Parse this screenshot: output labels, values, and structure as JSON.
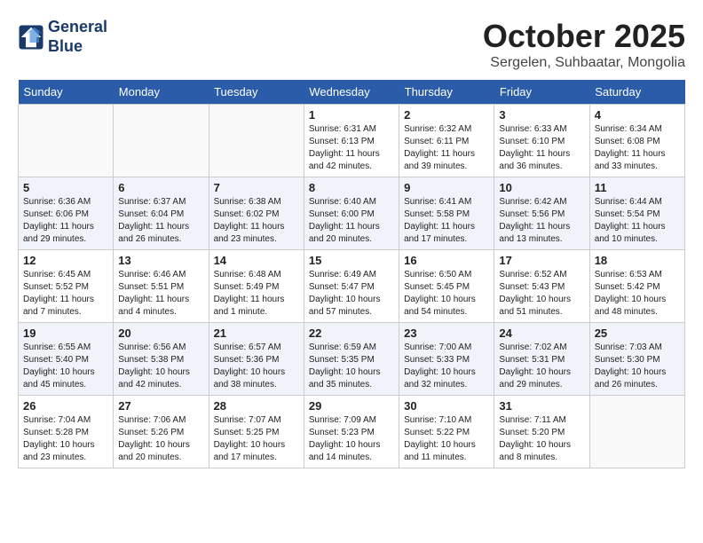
{
  "header": {
    "logo_line1": "General",
    "logo_line2": "Blue",
    "month": "October 2025",
    "location": "Sergelen, Suhbaatar, Mongolia"
  },
  "weekdays": [
    "Sunday",
    "Monday",
    "Tuesday",
    "Wednesday",
    "Thursday",
    "Friday",
    "Saturday"
  ],
  "weeks": [
    [
      {
        "day": "",
        "info": ""
      },
      {
        "day": "",
        "info": ""
      },
      {
        "day": "",
        "info": ""
      },
      {
        "day": "1",
        "info": "Sunrise: 6:31 AM\nSunset: 6:13 PM\nDaylight: 11 hours\nand 42 minutes."
      },
      {
        "day": "2",
        "info": "Sunrise: 6:32 AM\nSunset: 6:11 PM\nDaylight: 11 hours\nand 39 minutes."
      },
      {
        "day": "3",
        "info": "Sunrise: 6:33 AM\nSunset: 6:10 PM\nDaylight: 11 hours\nand 36 minutes."
      },
      {
        "day": "4",
        "info": "Sunrise: 6:34 AM\nSunset: 6:08 PM\nDaylight: 11 hours\nand 33 minutes."
      }
    ],
    [
      {
        "day": "5",
        "info": "Sunrise: 6:36 AM\nSunset: 6:06 PM\nDaylight: 11 hours\nand 29 minutes."
      },
      {
        "day": "6",
        "info": "Sunrise: 6:37 AM\nSunset: 6:04 PM\nDaylight: 11 hours\nand 26 minutes."
      },
      {
        "day": "7",
        "info": "Sunrise: 6:38 AM\nSunset: 6:02 PM\nDaylight: 11 hours\nand 23 minutes."
      },
      {
        "day": "8",
        "info": "Sunrise: 6:40 AM\nSunset: 6:00 PM\nDaylight: 11 hours\nand 20 minutes."
      },
      {
        "day": "9",
        "info": "Sunrise: 6:41 AM\nSunset: 5:58 PM\nDaylight: 11 hours\nand 17 minutes."
      },
      {
        "day": "10",
        "info": "Sunrise: 6:42 AM\nSunset: 5:56 PM\nDaylight: 11 hours\nand 13 minutes."
      },
      {
        "day": "11",
        "info": "Sunrise: 6:44 AM\nSunset: 5:54 PM\nDaylight: 11 hours\nand 10 minutes."
      }
    ],
    [
      {
        "day": "12",
        "info": "Sunrise: 6:45 AM\nSunset: 5:52 PM\nDaylight: 11 hours\nand 7 minutes."
      },
      {
        "day": "13",
        "info": "Sunrise: 6:46 AM\nSunset: 5:51 PM\nDaylight: 11 hours\nand 4 minutes."
      },
      {
        "day": "14",
        "info": "Sunrise: 6:48 AM\nSunset: 5:49 PM\nDaylight: 11 hours\nand 1 minute."
      },
      {
        "day": "15",
        "info": "Sunrise: 6:49 AM\nSunset: 5:47 PM\nDaylight: 10 hours\nand 57 minutes."
      },
      {
        "day": "16",
        "info": "Sunrise: 6:50 AM\nSunset: 5:45 PM\nDaylight: 10 hours\nand 54 minutes."
      },
      {
        "day": "17",
        "info": "Sunrise: 6:52 AM\nSunset: 5:43 PM\nDaylight: 10 hours\nand 51 minutes."
      },
      {
        "day": "18",
        "info": "Sunrise: 6:53 AM\nSunset: 5:42 PM\nDaylight: 10 hours\nand 48 minutes."
      }
    ],
    [
      {
        "day": "19",
        "info": "Sunrise: 6:55 AM\nSunset: 5:40 PM\nDaylight: 10 hours\nand 45 minutes."
      },
      {
        "day": "20",
        "info": "Sunrise: 6:56 AM\nSunset: 5:38 PM\nDaylight: 10 hours\nand 42 minutes."
      },
      {
        "day": "21",
        "info": "Sunrise: 6:57 AM\nSunset: 5:36 PM\nDaylight: 10 hours\nand 38 minutes."
      },
      {
        "day": "22",
        "info": "Sunrise: 6:59 AM\nSunset: 5:35 PM\nDaylight: 10 hours\nand 35 minutes."
      },
      {
        "day": "23",
        "info": "Sunrise: 7:00 AM\nSunset: 5:33 PM\nDaylight: 10 hours\nand 32 minutes."
      },
      {
        "day": "24",
        "info": "Sunrise: 7:02 AM\nSunset: 5:31 PM\nDaylight: 10 hours\nand 29 minutes."
      },
      {
        "day": "25",
        "info": "Sunrise: 7:03 AM\nSunset: 5:30 PM\nDaylight: 10 hours\nand 26 minutes."
      }
    ],
    [
      {
        "day": "26",
        "info": "Sunrise: 7:04 AM\nSunset: 5:28 PM\nDaylight: 10 hours\nand 23 minutes."
      },
      {
        "day": "27",
        "info": "Sunrise: 7:06 AM\nSunset: 5:26 PM\nDaylight: 10 hours\nand 20 minutes."
      },
      {
        "day": "28",
        "info": "Sunrise: 7:07 AM\nSunset: 5:25 PM\nDaylight: 10 hours\nand 17 minutes."
      },
      {
        "day": "29",
        "info": "Sunrise: 7:09 AM\nSunset: 5:23 PM\nDaylight: 10 hours\nand 14 minutes."
      },
      {
        "day": "30",
        "info": "Sunrise: 7:10 AM\nSunset: 5:22 PM\nDaylight: 10 hours\nand 11 minutes."
      },
      {
        "day": "31",
        "info": "Sunrise: 7:11 AM\nSunset: 5:20 PM\nDaylight: 10 hours\nand 8 minutes."
      },
      {
        "day": "",
        "info": ""
      }
    ]
  ]
}
